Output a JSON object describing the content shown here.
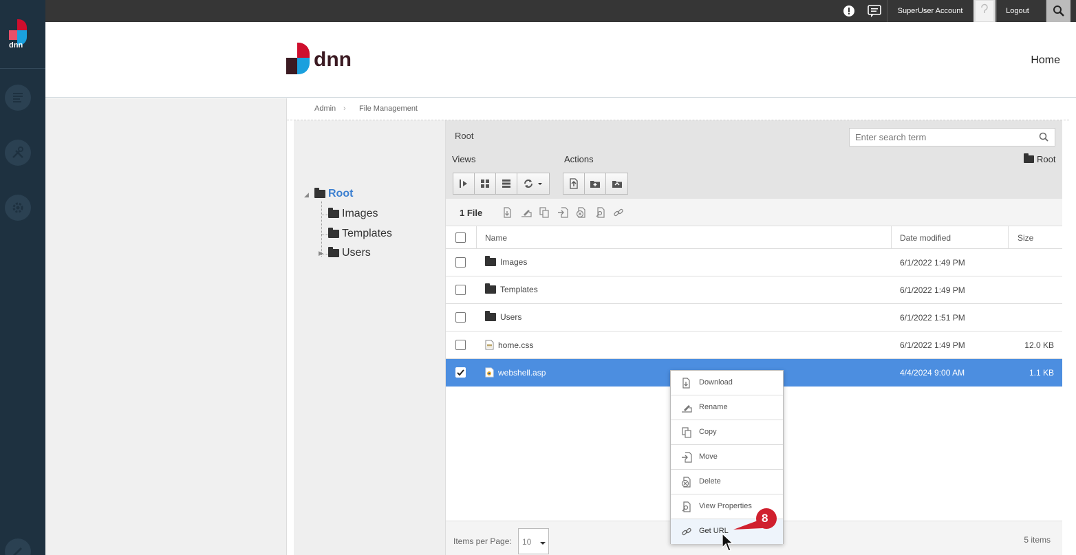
{
  "topbar": {
    "account": "SuperUser Account",
    "logout": "Logout"
  },
  "header": {
    "home": "Home"
  },
  "breadcrumb": [
    "Admin",
    "File Management"
  ],
  "tree": {
    "root": "Root",
    "children": [
      "Images",
      "Templates",
      "Users"
    ]
  },
  "toolbar": {
    "path": "Root",
    "search_placeholder": "Enter search term",
    "views_label": "Views",
    "actions_label": "Actions",
    "current_folder": "Root"
  },
  "file_bar": {
    "count": "1 File"
  },
  "grid": {
    "columns": [
      "Name",
      "Date modified",
      "Size"
    ],
    "rows": [
      {
        "name": "Images",
        "type": "folder",
        "date": "6/1/2022 1:49 PM",
        "size": "",
        "selected": false
      },
      {
        "name": "Templates",
        "type": "folder",
        "date": "6/1/2022 1:49 PM",
        "size": "",
        "selected": false
      },
      {
        "name": "Users",
        "type": "folder",
        "date": "6/1/2022 1:51 PM",
        "size": "",
        "selected": false
      },
      {
        "name": "home.css",
        "type": "file",
        "date": "6/1/2022 1:49 PM",
        "size": "12.0 KB",
        "selected": false
      },
      {
        "name": "webshell.asp",
        "type": "file",
        "date": "4/4/2024 9:00 AM",
        "size": "1.1 KB",
        "selected": true
      }
    ]
  },
  "footer": {
    "items_per_page_label": "Items per Page:",
    "items_per_page": "10",
    "total": "5 items"
  },
  "context_menu": {
    "items": [
      "Download",
      "Rename",
      "Copy",
      "Move",
      "Delete",
      "View Properties",
      "Get URL"
    ]
  },
  "step_badge": "8",
  "colors": {
    "sidebar": "#1e3140",
    "topbar": "#363636",
    "selection": "#4c8ee0",
    "brand_red": "#ce0e2d",
    "brand_blue": "#1aa0de"
  }
}
